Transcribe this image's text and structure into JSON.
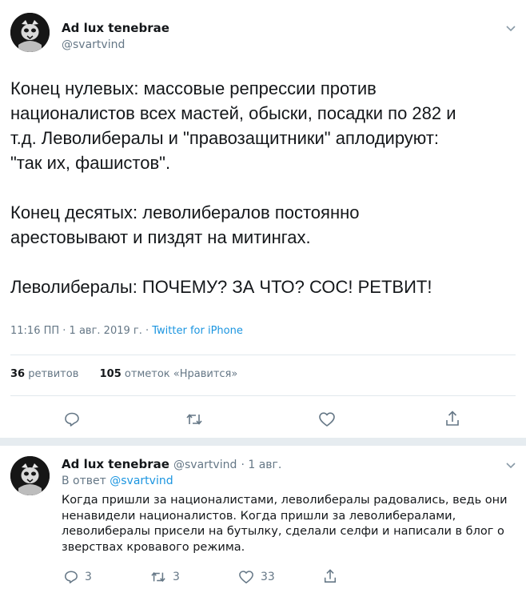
{
  "tweet": {
    "author_name": "Ad lux tenebrae",
    "author_handle": "@svartvind",
    "text_lines": [
      "Конец нулевых: массовые репрессии против",
      "националистов всех мастей, обыски, посадки по 282 и",
      "т.д. Леволибералы и \"правозащитники\" аплодируют:",
      "\"так их, фашистов\".",
      "",
      "Конец десятых: леволибералов постоянно",
      "арестовывают и пиздят на митингах.",
      "",
      "Леволибералы: ПОЧЕМУ? ЗА ЧТО? СОС! РЕТВИТ!"
    ],
    "timestamp": "11:16 ПП · 1 авг. 2019 г. · ",
    "source": "Twitter for iPhone",
    "retweets_count": "36",
    "retweets_label": "ретвитов",
    "likes_count": "105",
    "likes_label": "отметок «Нравится»"
  },
  "reply": {
    "author_name": "Ad lux tenebrae",
    "author_handle": "@svartvind",
    "date": "· 1 авг.",
    "reply_to_label": "В ответ",
    "reply_to_handle": "@svartvind",
    "text_lines": [
      "Когда пришли за националистами, леволибералы радовались, ведь они",
      "ненавидели националистов. Когда пришли за леволибералами,",
      "леволибералы присели на бутылку, сделали селфи и написали в блог о",
      "зверствах кровавого режима."
    ],
    "reply_count": "3",
    "retweet_count": "3",
    "like_count": "33"
  },
  "colors": {
    "text": "#14171a",
    "secondary": "#657786",
    "link": "#1b95e0",
    "divider": "#e1e8ed",
    "icon": "#8899a6"
  }
}
